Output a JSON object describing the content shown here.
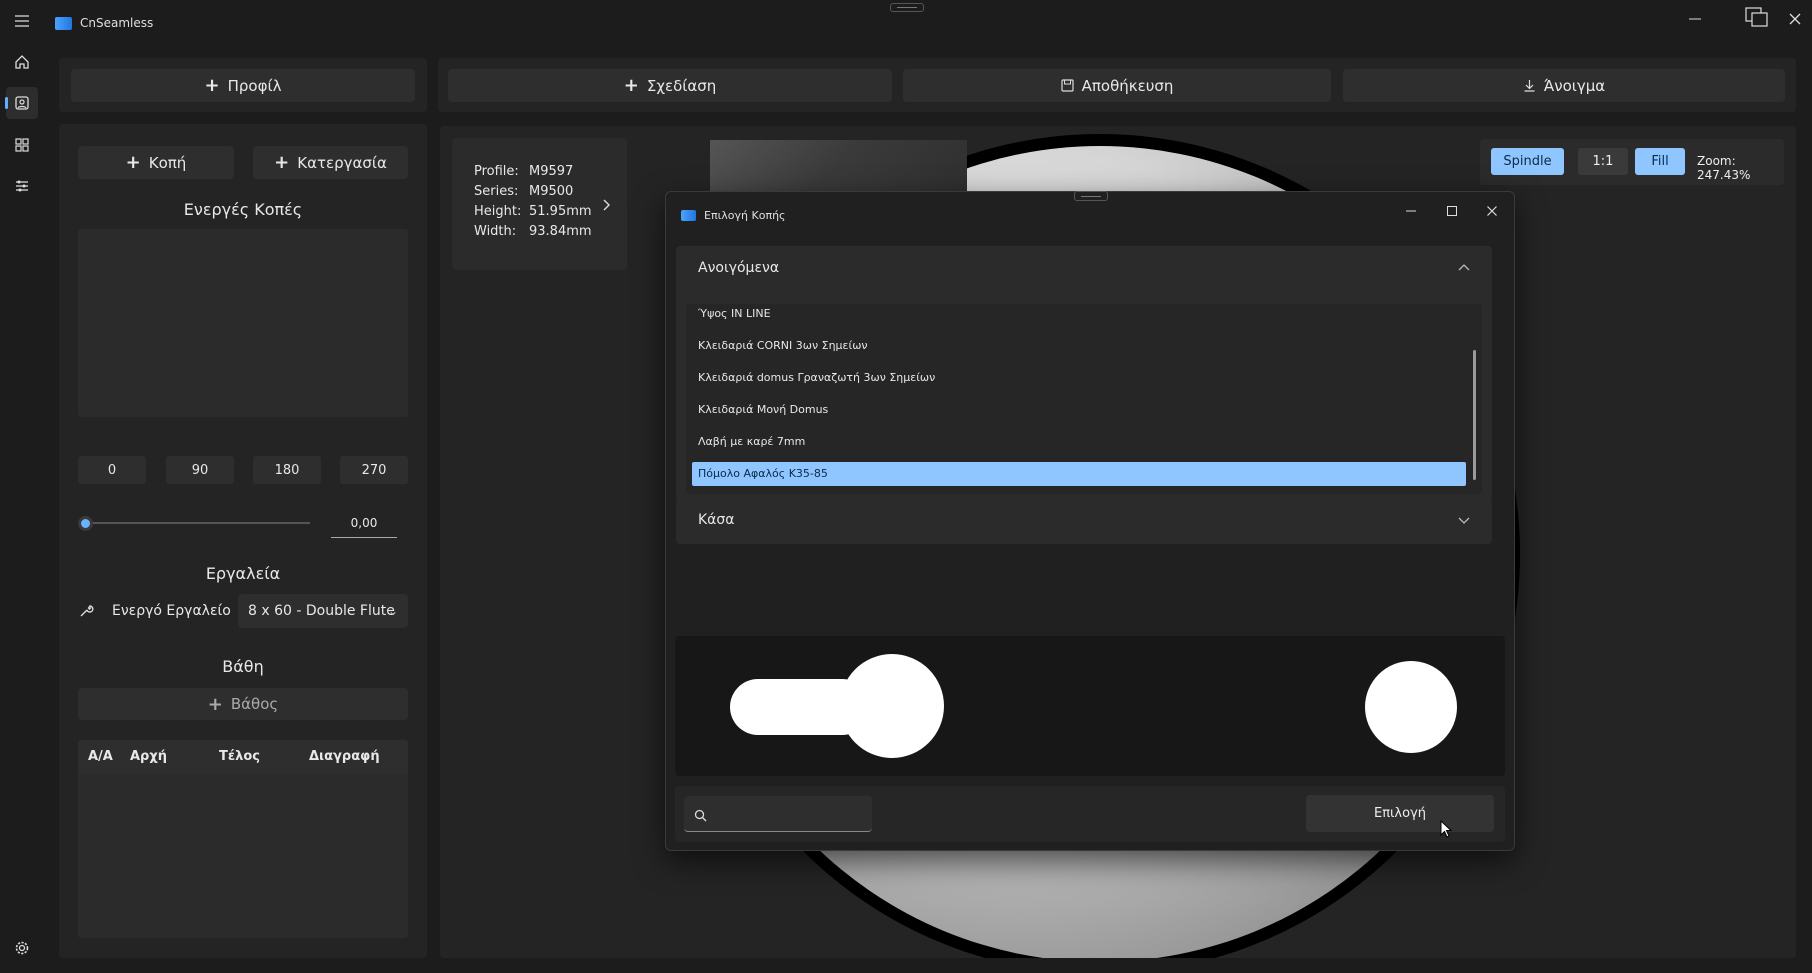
{
  "app": {
    "title": "CnSeamless"
  },
  "toolbar": {
    "profile_label": "Προφίλ",
    "design_label": "Σχεδίαση",
    "save_label": "Αποθήκευση",
    "open_label": "Άνοιγμα"
  },
  "left_panel": {
    "cut_label": "Κοπή",
    "machining_label": "Κατεργασία",
    "active_cuts_title": "Ενεργές Κοπές",
    "angles": [
      "0",
      "90",
      "180",
      "270"
    ],
    "rotation_value": "0,00",
    "tools_title": "Εργαλεία",
    "active_tool_label": "Ενεργό Εργαλείο",
    "active_tool_value": "8 x 60 - Double Flute",
    "depths_title": "Βάθη",
    "add_depth_label": "Βάθος",
    "table_headers": [
      "Α/Α",
      "Αρχή",
      "Τέλος",
      "Διαγραφή"
    ]
  },
  "profile_info": {
    "profile_key": "Profile:",
    "profile_value": "M9597",
    "series_key": "Series:",
    "series_value": "M9500",
    "height_key": "Height:",
    "height_value": "51.95mm",
    "width_key": "Width:",
    "width_value": "93.84mm"
  },
  "view_toolbar": {
    "spindle_label": "Spindle",
    "ratio_label": "1:1",
    "fill_label": "Fill",
    "zoom_text": "Zoom: 247.43%"
  },
  "dialog": {
    "title": "Επιλογή Κοπής",
    "section1_title": "Ανοιγόμενα",
    "section2_title": "Κάσα",
    "items": [
      "Ύψος IN LINE",
      "Κλειδαριά CORNI 3ων Σημείων",
      "Κλειδαριά domus Γραναζωτή 3ων Σημείων",
      "Κλειδαριά Μονή Domus",
      "Λαβή με καρέ 7mm",
      "Πόμολο Αφαλός Κ35-85"
    ],
    "selected_index": 5,
    "search_placeholder": "",
    "select_button": "Επιλογή"
  },
  "colors": {
    "accent": "#8fc6ff",
    "background": "#1c1c1c",
    "panel": "#242424"
  }
}
